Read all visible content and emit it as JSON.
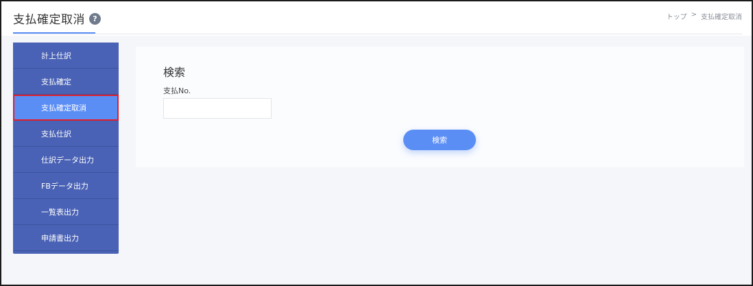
{
  "header": {
    "title": "支払確定取消",
    "help_icon": "?",
    "breadcrumb": {
      "home": "トップ",
      "separator": ">",
      "current": "支払確定取消"
    }
  },
  "sidebar": {
    "items": [
      {
        "label": "計上仕訳"
      },
      {
        "label": "支払確定"
      },
      {
        "label": "支払確定取消",
        "active": true
      },
      {
        "label": "支払仕訳"
      },
      {
        "label": "仕訳データ出力"
      },
      {
        "label": "FBデータ出力"
      },
      {
        "label": "一覧表出力"
      },
      {
        "label": "申請書出力"
      }
    ]
  },
  "search_panel": {
    "title": "検索",
    "field_label": "支払No.",
    "field_value": "",
    "button_label": "検索"
  },
  "colors": {
    "accent": "#5b8ef5",
    "sidebar": "#4a62b5",
    "highlight_border": "#e01e2a"
  }
}
